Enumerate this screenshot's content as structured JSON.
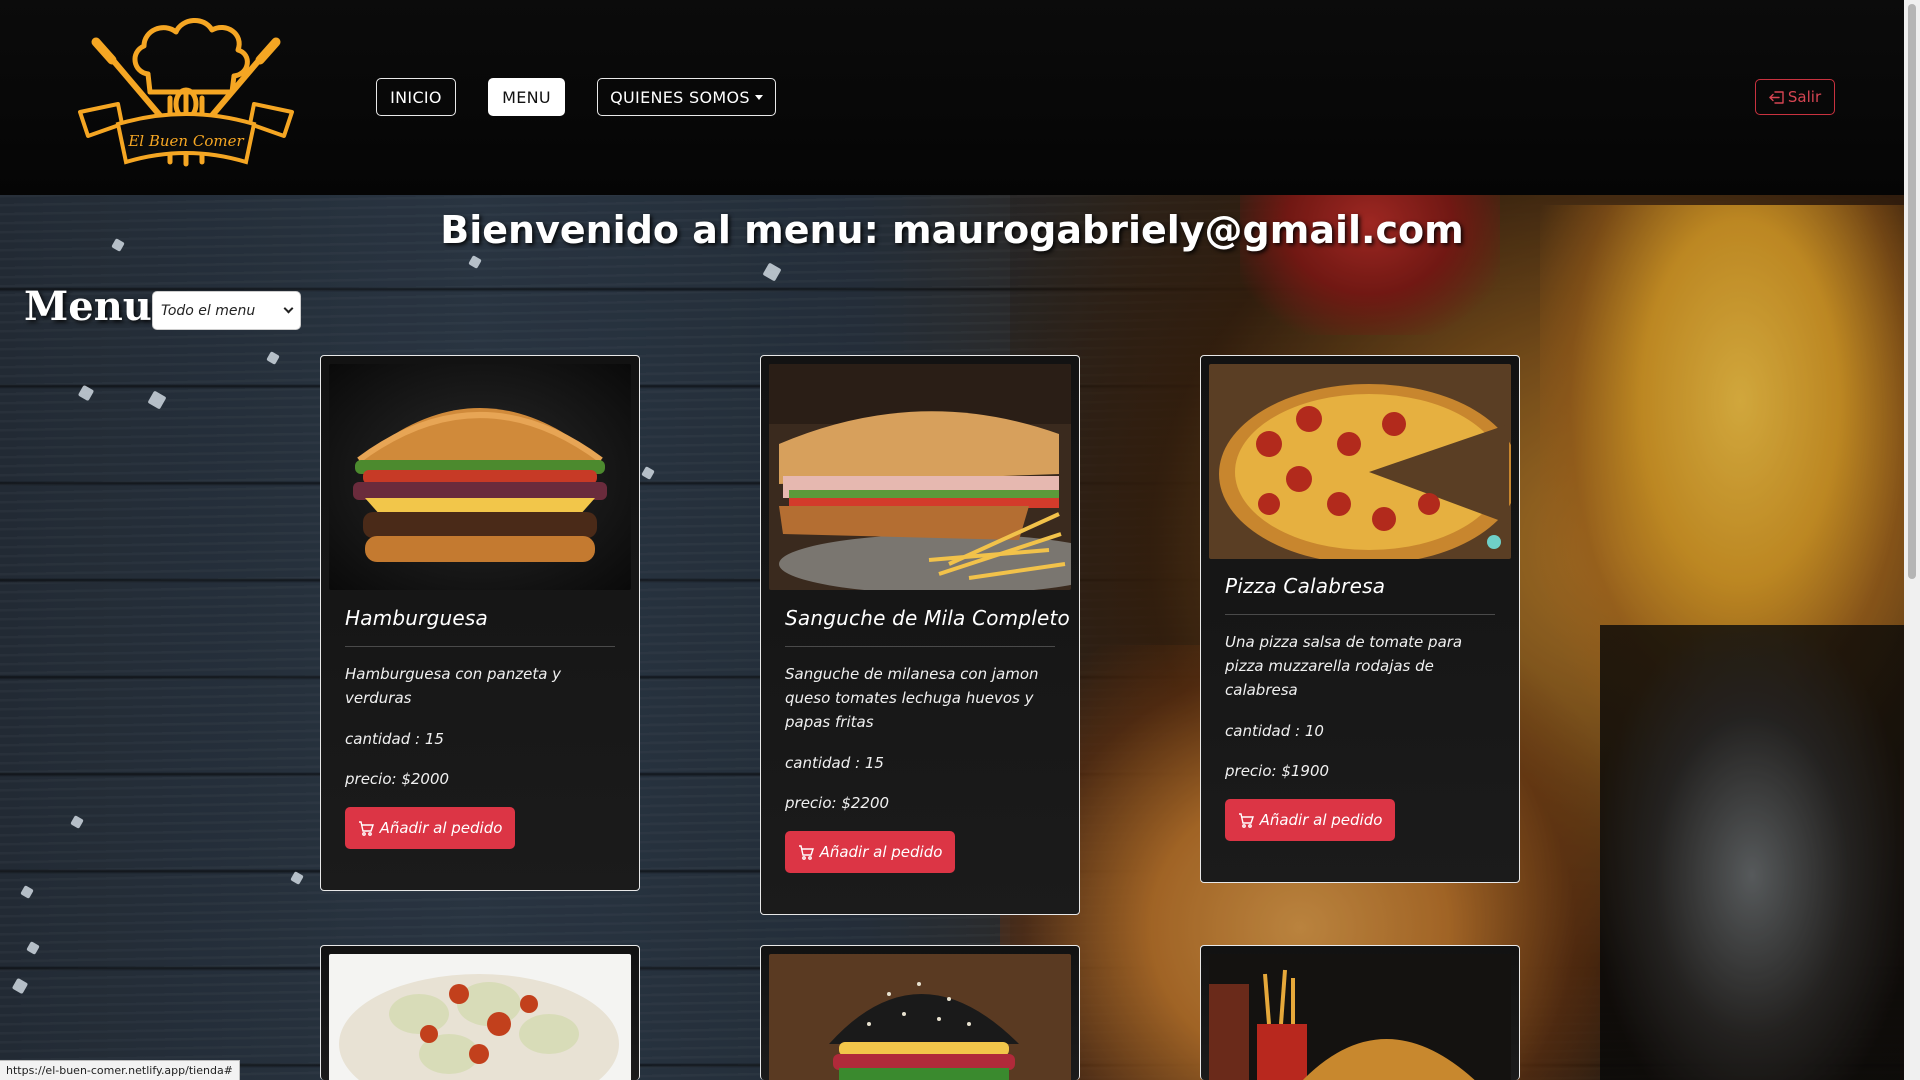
{
  "nav": {
    "logo_text": "El Buen Comer",
    "items": [
      {
        "label": "INICIO",
        "active": false
      },
      {
        "label": "MENU",
        "active": true
      },
      {
        "label": "QUIENES SOMOS",
        "active": false
      }
    ],
    "logout_label": "Salir"
  },
  "welcome": "Bienvenido al menu: maurogabriely@gmail.com",
  "menus_title": "Menus",
  "filter": {
    "selected": "Todo el menu"
  },
  "cards": [
    {
      "title": "Hamburguesa",
      "description": "Hamburguesa con panzeta y verduras",
      "quantity": "cantidad : 15",
      "price": "precio: $2000",
      "button": "Añadir al pedido"
    },
    {
      "title": "Sanguche de Mila Completo",
      "description": "Sanguche de milanesa con jamon queso tomates lechuga huevos y papas fritas",
      "quantity": "cantidad : 15",
      "price": "precio: $2200",
      "button": "Añadir al pedido"
    },
    {
      "title": "Pizza Calabresa",
      "description": "Una pizza salsa de tomate para pizza muzzarella rodajas de calabresa",
      "quantity": "cantidad : 10",
      "price": "precio: $1900",
      "button": "Añadir al pedido"
    }
  ],
  "status_url": "https://el-buen-comer.netlify.app/tienda#",
  "colors": {
    "accent": "#dc3545",
    "logo": "#f5a623"
  }
}
